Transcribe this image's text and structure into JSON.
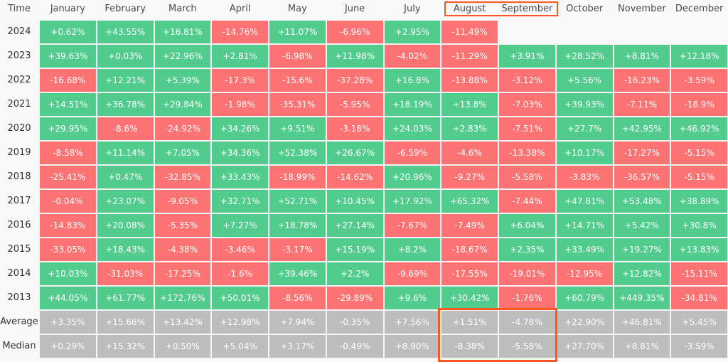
{
  "chart_data": {
    "type": "heatmap",
    "title": "",
    "corner_label": "Time",
    "columns": [
      "January",
      "February",
      "March",
      "April",
      "May",
      "June",
      "July",
      "August",
      "September",
      "October",
      "November",
      "December"
    ],
    "rows": [
      {
        "label": "2024",
        "kind": "year",
        "values": [
          "+0.62%",
          "+43.55%",
          "+16.81%",
          "-14.76%",
          "+11.07%",
          "-6.96%",
          "+2.95%",
          "-11.49%",
          null,
          null,
          null,
          null
        ]
      },
      {
        "label": "2023",
        "kind": "year",
        "values": [
          "+39.63%",
          "+0.03%",
          "+22.96%",
          "+2.81%",
          "-6.98%",
          "+11.98%",
          "-4.02%",
          "-11.29%",
          "+3.91%",
          "+28.52%",
          "+8.81%",
          "+12.18%"
        ]
      },
      {
        "label": "2022",
        "kind": "year",
        "values": [
          "-16.68%",
          "+12.21%",
          "+5.39%",
          "-17.3%",
          "-15.6%",
          "-37.28%",
          "+16.8%",
          "-13.88%",
          "-3.12%",
          "+5.56%",
          "-16.23%",
          "-3.59%"
        ]
      },
      {
        "label": "2021",
        "kind": "year",
        "values": [
          "+14.51%",
          "+36.78%",
          "+29.84%",
          "-1.98%",
          "-35.31%",
          "-5.95%",
          "+18.19%",
          "+13.8%",
          "-7.03%",
          "+39.93%",
          "-7.11%",
          "-18.9%"
        ]
      },
      {
        "label": "2020",
        "kind": "year",
        "values": [
          "+29.95%",
          "-8.6%",
          "-24.92%",
          "+34.26%",
          "+9.51%",
          "-3.18%",
          "+24.03%",
          "+2.83%",
          "-7.51%",
          "+27.7%",
          "+42.95%",
          "+46.92%"
        ]
      },
      {
        "label": "2019",
        "kind": "year",
        "values": [
          "-8.58%",
          "+11.14%",
          "+7.05%",
          "+34.36%",
          "+52.38%",
          "+26.67%",
          "-6.59%",
          "-4.6%",
          "-13.38%",
          "+10.17%",
          "-17.27%",
          "-5.15%"
        ]
      },
      {
        "label": "2018",
        "kind": "year",
        "values": [
          "-25.41%",
          "+0.47%",
          "-32.85%",
          "+33.43%",
          "-18.99%",
          "-14.62%",
          "+20.96%",
          "-9.27%",
          "-5.58%",
          "-3.83%",
          "-36.57%",
          "-5.15%"
        ]
      },
      {
        "label": "2017",
        "kind": "year",
        "values": [
          "-0.04%",
          "+23.07%",
          "-9.05%",
          "+32.71%",
          "+52.71%",
          "+10.45%",
          "+17.92%",
          "+65.32%",
          "-7.44%",
          "+47.81%",
          "+53.48%",
          "+38.89%"
        ]
      },
      {
        "label": "2016",
        "kind": "year",
        "values": [
          "-14.83%",
          "+20.08%",
          "-5.35%",
          "+7.27%",
          "+18.78%",
          "+27.14%",
          "-7.67%",
          "-7.49%",
          "+6.04%",
          "+14.71%",
          "+5.42%",
          "+30.8%"
        ]
      },
      {
        "label": "2015",
        "kind": "year",
        "values": [
          "-33.05%",
          "+18.43%",
          "-4.38%",
          "-3.46%",
          "-3.17%",
          "+15.19%",
          "+8.2%",
          "-18.67%",
          "+2.35%",
          "+33.49%",
          "+19.27%",
          "+13.83%"
        ]
      },
      {
        "label": "2014",
        "kind": "year",
        "values": [
          "+10.03%",
          "-31.03%",
          "-17.25%",
          "-1.6%",
          "+39.46%",
          "+2.2%",
          "-9.69%",
          "-17.55%",
          "-19.01%",
          "-12.95%",
          "+12.82%",
          "-15.11%"
        ]
      },
      {
        "label": "2013",
        "kind": "year",
        "values": [
          "+44.05%",
          "+61.77%",
          "+172.76%",
          "+50.01%",
          "-8.56%",
          "-29.89%",
          "+9.6%",
          "+30.42%",
          "-1.76%",
          "+60.79%",
          "+449.35%",
          "-34.81%"
        ]
      },
      {
        "label": "Average",
        "kind": "stat",
        "values": [
          "+3.35%",
          "+15.66%",
          "+13.42%",
          "+12.98%",
          "+7.94%",
          "-0.35%",
          "+7.56%",
          "+1.51%",
          "-4.78%",
          "+22.90%",
          "+46.81%",
          "+5.45%"
        ]
      },
      {
        "label": "Median",
        "kind": "stat",
        "values": [
          "+0.29%",
          "+15.32%",
          "+0.50%",
          "+5.04%",
          "+3.17%",
          "-0.49%",
          "+8.90%",
          "-8.38%",
          "-5.58%",
          "+27.70%",
          "+8.81%",
          "-3.59%"
        ]
      }
    ],
    "highlights": [
      {
        "target": "header",
        "columns": [
          "August",
          "September"
        ]
      },
      {
        "target": "stats",
        "columns": [
          "August",
          "September"
        ],
        "rows": [
          "Average",
          "Median"
        ]
      }
    ],
    "colors": {
      "positive": "#52cc8d",
      "negative": "#fd7373",
      "stat": "#bdbdbd",
      "highlight": "#ff5722"
    }
  }
}
